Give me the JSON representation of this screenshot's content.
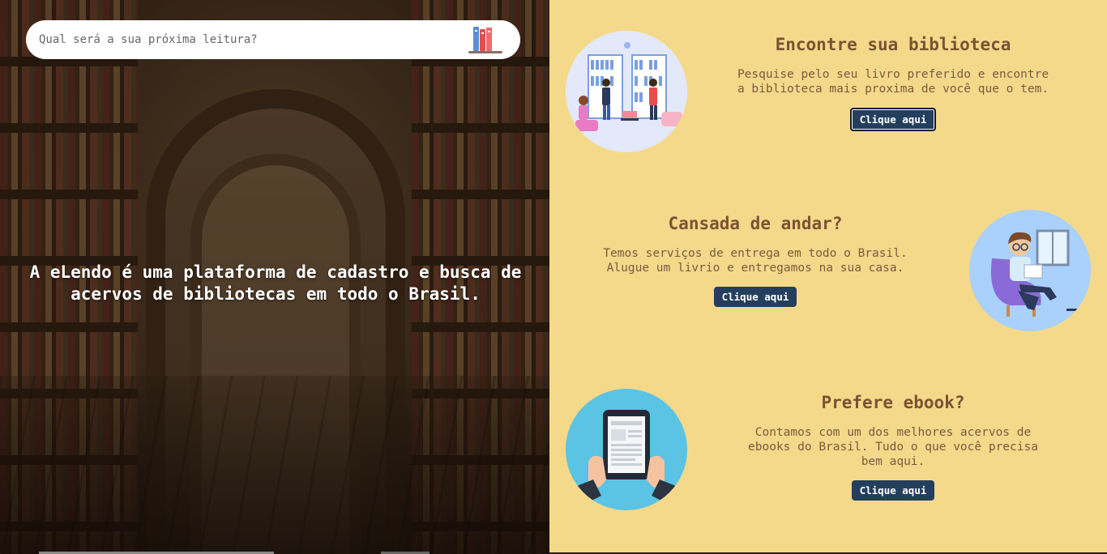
{
  "search": {
    "placeholder": "Qual será a sua próxima leitura?"
  },
  "hero": {
    "text": "A eLendo é uma plataforma de cadastro e busca de acervos de bibliotecas em todo o Brasil."
  },
  "cards": [
    {
      "title": "Encontre sua biblioteca",
      "text": "Pesquise pelo seu livro preferido e encontre a biblioteca mais proxima de você que o tem.",
      "button": "Clique aqui",
      "image": "library-illustration"
    },
    {
      "title": "Cansada de andar?",
      "text": "Temos serviços de entrega em todo o Brasil. Alugue um livrio e entregamos na sua casa.",
      "button": "Clique aqui",
      "image": "reading-chair-illustration"
    },
    {
      "title": "Prefere ebook?",
      "text": "Contamos com um dos melhores acervos de ebooks do Brasil. Tudo o que você precisa bem aqui.",
      "button": "Clique aqui",
      "image": "tablet-ebook-illustration"
    }
  ],
  "colors": {
    "panel": "#f5d98b",
    "button": "#243f5e",
    "heading": "#7a5332"
  }
}
